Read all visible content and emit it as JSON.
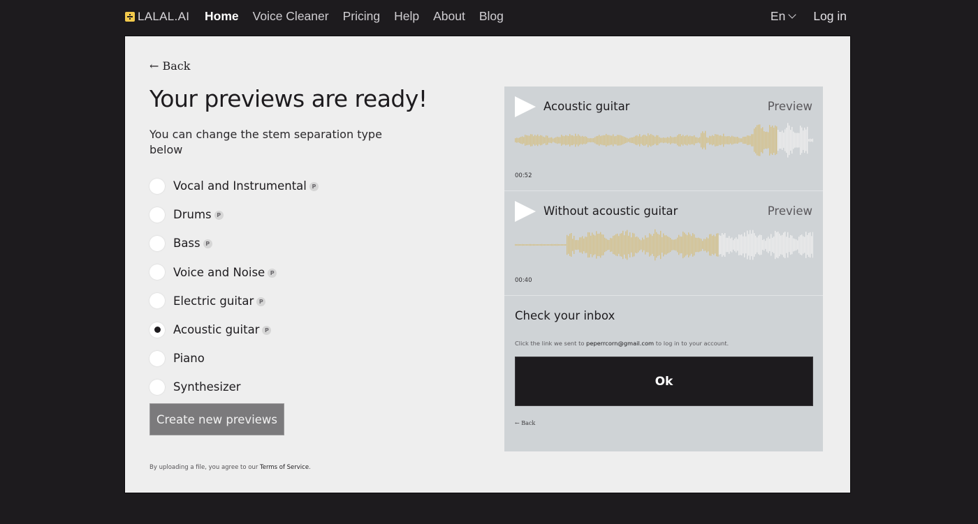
{
  "nav": {
    "logo_text": "LALAL.AI",
    "links": [
      {
        "label": "Home",
        "active": true
      },
      {
        "label": "Voice Cleaner",
        "active": false
      },
      {
        "label": "Pricing",
        "active": false
      },
      {
        "label": "Help",
        "active": false
      },
      {
        "label": "About",
        "active": false
      },
      {
        "label": "Blog",
        "active": false
      }
    ],
    "language": "En",
    "login_label": "Log in"
  },
  "main": {
    "back_label": "← Back",
    "title": "Your previews are ready!",
    "subtitle": "You can change the stem separation type below",
    "options": [
      {
        "label": "Vocal and Instrumental",
        "badge": "P",
        "selected": false
      },
      {
        "label": "Drums",
        "badge": "P",
        "selected": false
      },
      {
        "label": "Bass",
        "badge": "P",
        "selected": false
      },
      {
        "label": "Voice and Noise",
        "badge": "P",
        "selected": false
      },
      {
        "label": "Electric guitar",
        "badge": "P",
        "selected": false
      },
      {
        "label": "Acoustic guitar",
        "badge": "P",
        "selected": true
      },
      {
        "label": "Piano",
        "badge": null,
        "selected": false
      },
      {
        "label": "Synthesizer",
        "badge": null,
        "selected": false
      }
    ],
    "create_button": "Create new previews",
    "tos_prefix": "By uploading a file, you agree to our ",
    "tos_link": "Terms of Service",
    "tos_suffix": "."
  },
  "panel": {
    "tracks": [
      {
        "name": "Acoustic guitar",
        "preview_label": "Preview",
        "time": "00:52",
        "progress": 0.88
      },
      {
        "name": "Without acoustic guitar",
        "preview_label": "Preview",
        "time": "00:40",
        "progress": 0.68
      }
    ],
    "inbox": {
      "title": "Check your inbox",
      "msg_prefix": "Click the link we sent to ",
      "email": "peperrcorn@gmail.com",
      "msg_suffix": " to log in to your account.",
      "ok_label": "Ok",
      "back_label": "← Back"
    }
  },
  "colors": {
    "played": "#d4c089",
    "unplayed": "#eeeeee",
    "accent_logo": "#f2c94c"
  }
}
